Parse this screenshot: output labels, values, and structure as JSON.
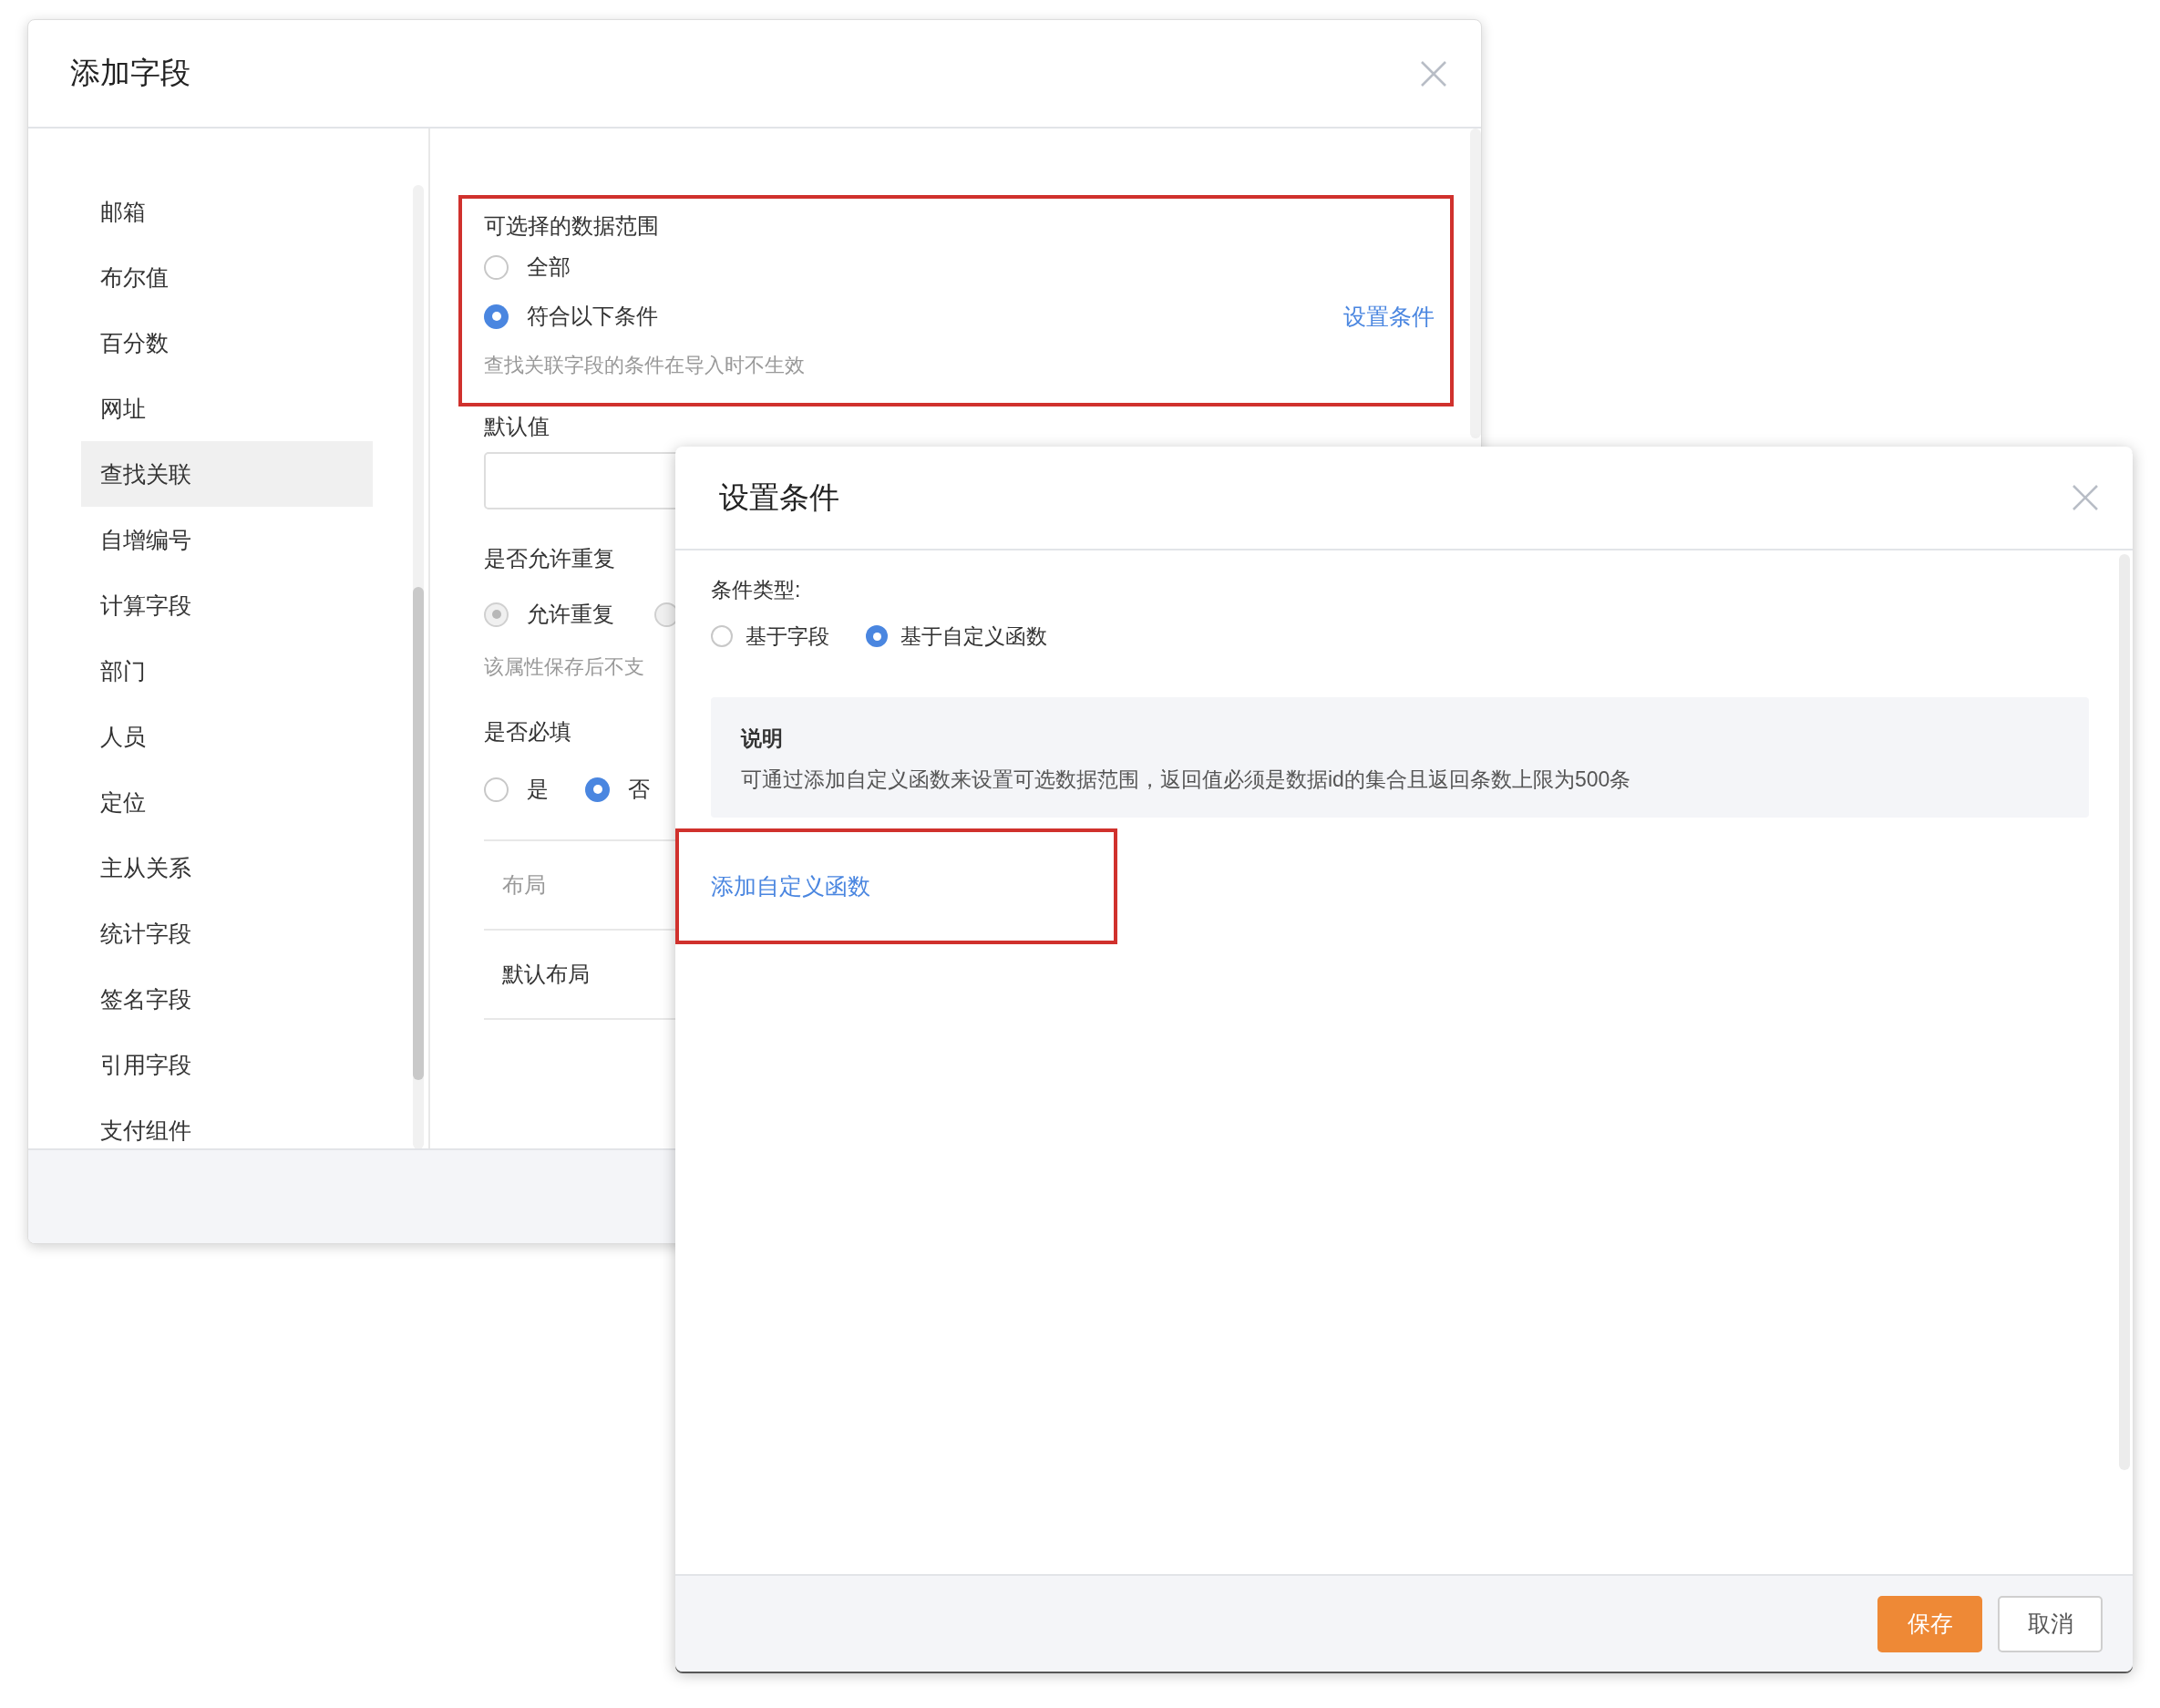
{
  "add_field_dialog": {
    "title": "添加字段",
    "field_types": [
      {
        "label": "邮箱",
        "selected": false
      },
      {
        "label": "布尔值",
        "selected": false
      },
      {
        "label": "百分数",
        "selected": false
      },
      {
        "label": "网址",
        "selected": false
      },
      {
        "label": "查找关联",
        "selected": true
      },
      {
        "label": "自增编号",
        "selected": false
      },
      {
        "label": "计算字段",
        "selected": false
      },
      {
        "label": "部门",
        "selected": false
      },
      {
        "label": "人员",
        "selected": false
      },
      {
        "label": "定位",
        "selected": false
      },
      {
        "label": "主从关系",
        "selected": false
      },
      {
        "label": "统计字段",
        "selected": false
      },
      {
        "label": "签名字段",
        "selected": false
      },
      {
        "label": "引用字段",
        "selected": false
      },
      {
        "label": "支付组件",
        "selected": false
      }
    ],
    "data_range": {
      "label": "可选择的数据范围",
      "options": [
        {
          "label": "全部",
          "selected": false
        },
        {
          "label": "符合以下条件",
          "selected": true
        }
      ],
      "link": "设置条件",
      "hint": "查找关联字段的条件在导入时不生效"
    },
    "default_value": {
      "label": "默认值"
    },
    "allow_duplicates": {
      "label": "是否允许重复",
      "options": [
        {
          "label": "允许重复",
          "selected": true,
          "disabled": true
        },
        {
          "selected": false,
          "disabled": true
        }
      ],
      "hint": "该属性保存后不支"
    },
    "required": {
      "label": "是否必填",
      "options": [
        {
          "label": "是",
          "selected": false
        },
        {
          "label": "否",
          "selected": true
        }
      ]
    },
    "layout_table": {
      "header": "布局",
      "rows": [
        "默认布局"
      ]
    }
  },
  "set_condition_dialog": {
    "title": "设置条件",
    "condition_type": {
      "label": "条件类型:",
      "options": [
        {
          "label": "基于字段",
          "selected": false
        },
        {
          "label": "基于自定义函数",
          "selected": true
        }
      ]
    },
    "note": {
      "title": "说明",
      "text": "可通过添加自定义函数来设置可选数据范围，返回值必须是数据id的集合且返回条数上限为500条"
    },
    "add_function_link": "添加自定义函数",
    "buttons": [
      {
        "label": "保存",
        "kind": "primary"
      },
      {
        "label": "取消",
        "kind": "default"
      }
    ]
  }
}
